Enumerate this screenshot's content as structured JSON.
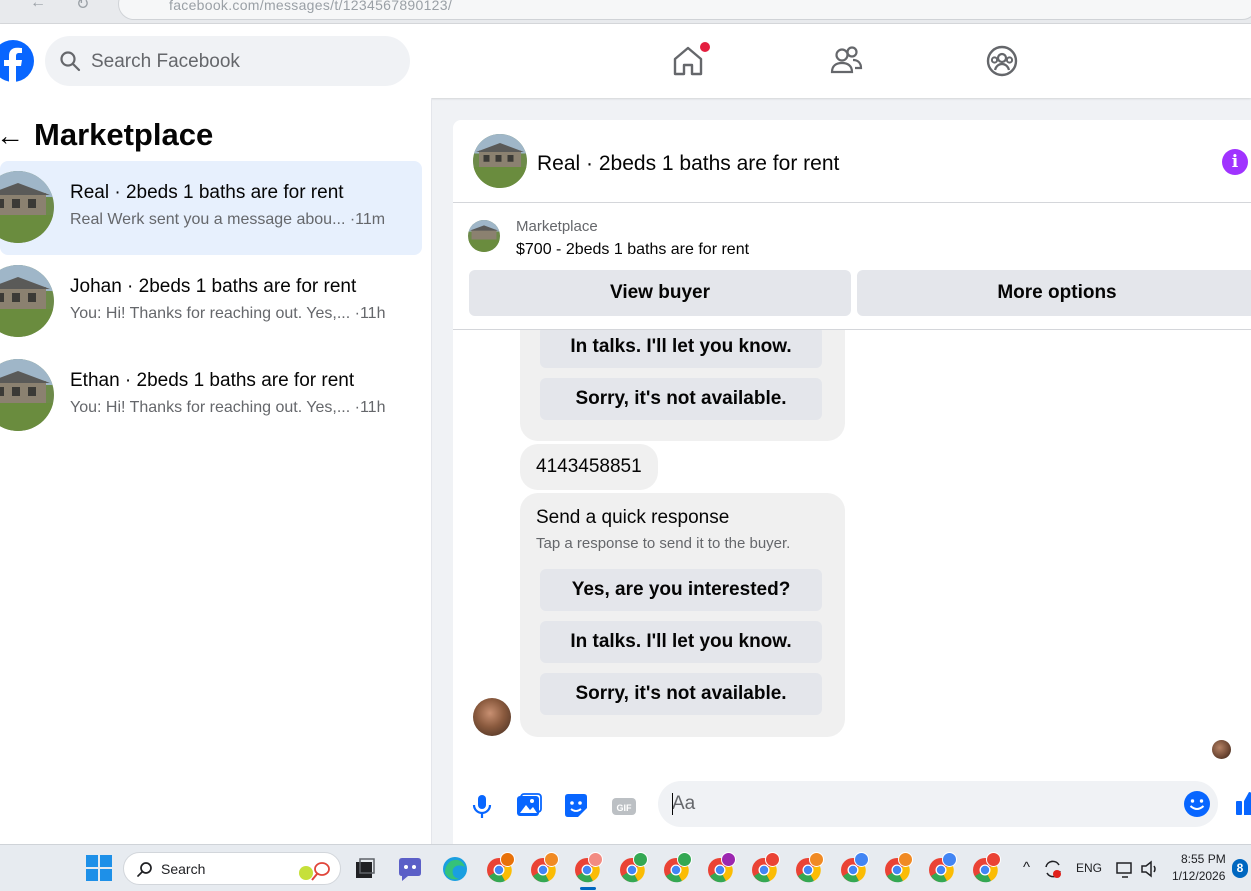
{
  "browser": {
    "url": "facebook.com/messages/t/1234567890123/"
  },
  "header": {
    "search_placeholder": "Search Facebook",
    "colors": {
      "brand": "#0866ff",
      "notification": "#e41e3f"
    }
  },
  "sidebar": {
    "title": "Marketplace",
    "conversations": [
      {
        "title": "Real · 2beds 1 baths are for rent",
        "preview": "Real Werk sent you a message abou... ·11m",
        "active": true
      },
      {
        "title": "Johan · 2beds 1 baths are for rent",
        "preview": "You: Hi! Thanks for reaching out. Yes,... ·11h",
        "active": false
      },
      {
        "title": "Ethan · 2beds 1 baths are for rent",
        "preview": "You: Hi! Thanks for reaching out. Yes,... ·11h",
        "active": false
      }
    ]
  },
  "chat": {
    "title": "Real · 2beds 1 baths are for rent",
    "listing": {
      "label": "Marketplace",
      "price_title": "$700 - 2beds 1 baths are for rent",
      "view_buyer": "View buyer",
      "more_options": "More options"
    },
    "earlier_quick_replies": [
      "In talks. I'll let you know.",
      "Sorry, it's not available."
    ],
    "phone_message": "4143458851",
    "quick_response": {
      "title": "Send a quick response",
      "subtitle": "Tap a response to send it to the buyer.",
      "options": [
        "Yes, are you interested?",
        "In talks. I'll let you know.",
        "Sorry, it's not available."
      ]
    },
    "composer": {
      "placeholder": "Aa"
    },
    "colors": {
      "info": "#a033ff",
      "accent": "#0866ff"
    }
  },
  "taskbar": {
    "search_placeholder": "Search",
    "language": "ENG",
    "time": "8:55 PM",
    "date": "1/12/2026",
    "notification_count": "8",
    "apps": [
      "chrome-profile-r",
      "chrome-profile-orange",
      "chrome-profile-active",
      "chrome-profile-green",
      "chrome-profile-green",
      "chrome-profile-purple",
      "chrome-profile-red",
      "chrome-profile-orange",
      "chrome-profile-blue",
      "chrome-profile-orange",
      "chrome-profile-blue",
      "chrome-profile-red"
    ]
  }
}
